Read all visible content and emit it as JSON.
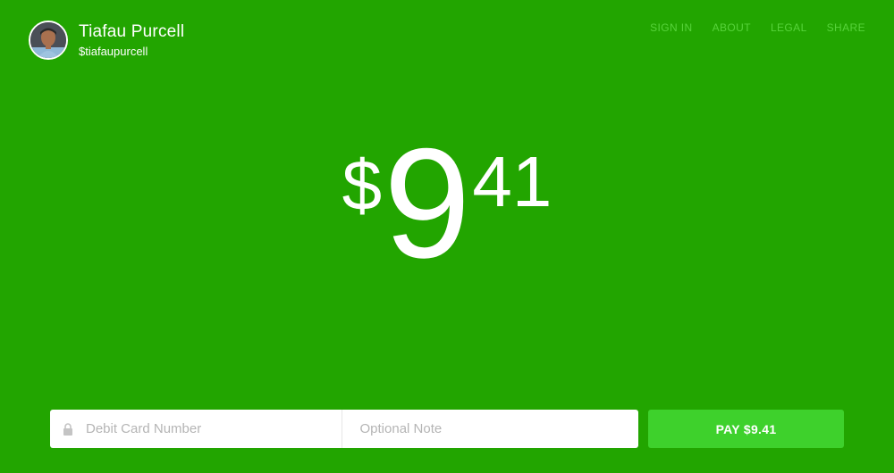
{
  "profile": {
    "name": "Tiafau Purcell",
    "handle": "$tiafaupurcell",
    "avatar_icon": "avatar-photo"
  },
  "nav": {
    "items": [
      {
        "label": "SIGN IN"
      },
      {
        "label": "ABOUT"
      },
      {
        "label": "LEGAL"
      },
      {
        "label": "SHARE"
      }
    ]
  },
  "amount": {
    "symbol": "$",
    "whole": "9",
    "cents": "41"
  },
  "form": {
    "card_placeholder": "Debit Card Number",
    "card_value": "",
    "note_placeholder": "Optional Note",
    "note_value": "",
    "lock_icon": "lock-icon"
  },
  "pay_button": {
    "label": "PAY $9.41"
  },
  "colors": {
    "background": "#22a500",
    "nav_text": "#57d33a",
    "pay_button": "#3ed12c",
    "text": "#ffffff"
  }
}
